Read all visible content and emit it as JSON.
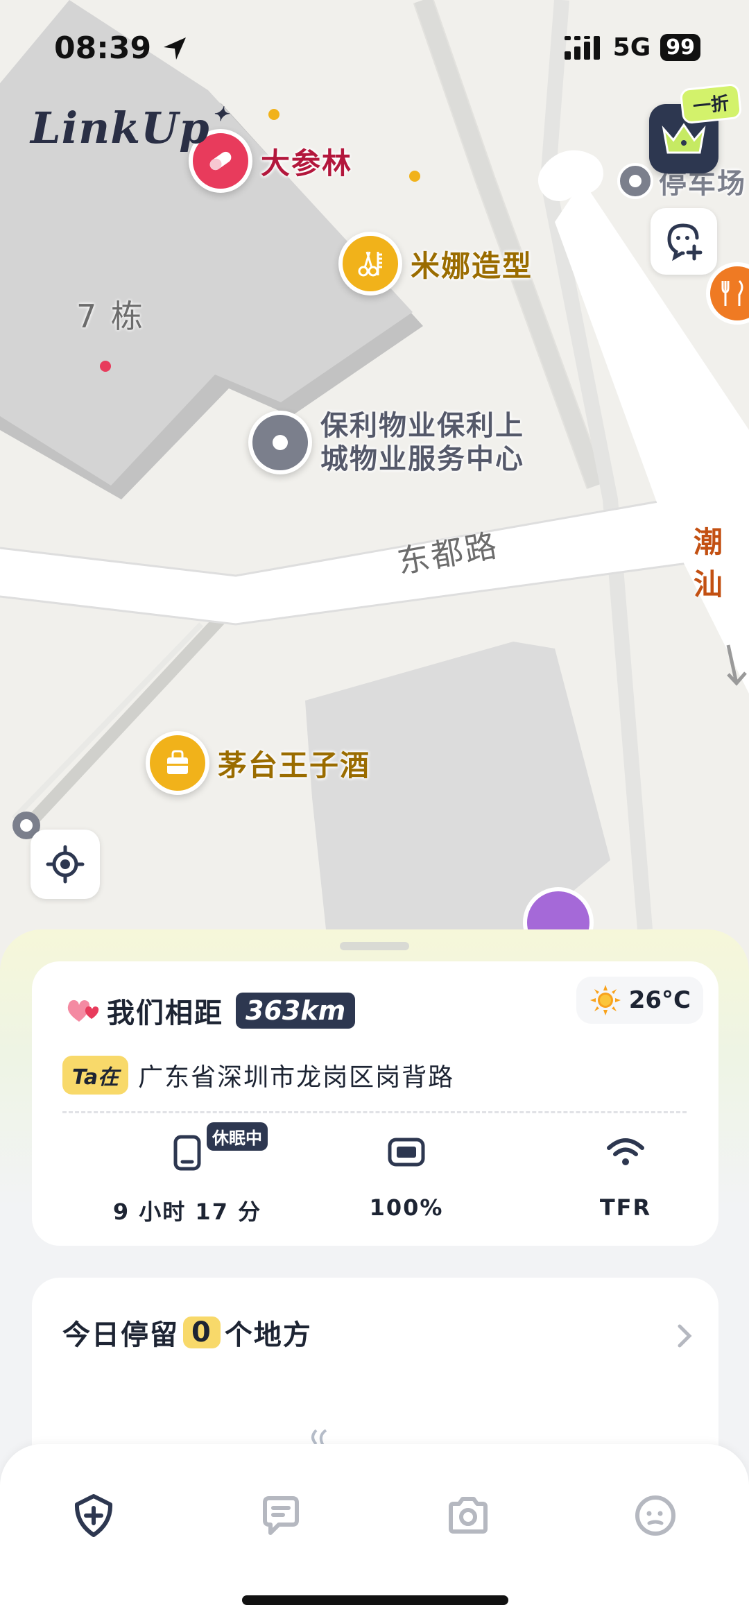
{
  "status_bar": {
    "time": "08:39",
    "network": "5G",
    "battery": "99"
  },
  "app": {
    "logo": "LinkUp",
    "discount_badge": "一折"
  },
  "map": {
    "pois": [
      {
        "name": "大参林",
        "color": "#e83b5c"
      },
      {
        "name": "米娜造型",
        "color": "#f1b21a"
      },
      {
        "name": "保利物业保利上城物业服务中心",
        "line1": "保利物业保利上",
        "line2": "城物业服务中心",
        "color": "#7b7f8c"
      },
      {
        "name": "茅台王子酒",
        "color": "#f1b21a"
      },
      {
        "name": "停车场",
        "color": "#7b7f8c"
      },
      {
        "name": "潮汕",
        "color": "#e06a1e"
      }
    ],
    "labels": {
      "building": "7 栋",
      "road": "东都路"
    }
  },
  "distance_card": {
    "label": "我们相距",
    "value": "363km",
    "temperature": "26°C",
    "ta_badge": "Ta在",
    "location": "广东省深圳市龙岗区岗背路",
    "metrics": [
      {
        "name": "screen",
        "value": "9 小时 17 分",
        "badge": "休眠中"
      },
      {
        "name": "battery",
        "value": "100%"
      },
      {
        "name": "wifi",
        "value": "TFR"
      }
    ]
  },
  "stay_card": {
    "prefix": "今日停留",
    "count": "0",
    "suffix": "个地方"
  },
  "tabbar": {
    "items": [
      "home",
      "messages",
      "camera",
      "profile"
    ]
  },
  "colors": {
    "accent": "#2d3750",
    "highlight": "#f8d96a",
    "lime": "#d3f26b"
  }
}
